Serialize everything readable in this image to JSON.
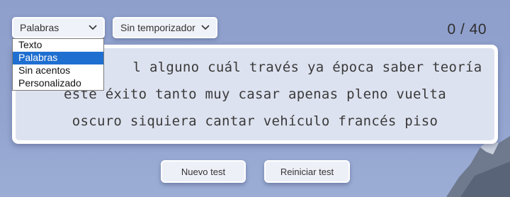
{
  "mode_select": {
    "value": "Palabras",
    "options": [
      "Texto",
      "Palabras",
      "Sin acentos",
      "Personalizado"
    ],
    "highlighted": "Palabras"
  },
  "timer_select": {
    "value": "Sin temporizador"
  },
  "counter": "0 / 40",
  "text_lines": [
    "l alguno cuál través ya época saber teoría",
    "este éxito tanto muy casar apenas pleno vuelta",
    "oscuro siquiera cantar vehículo francés piso"
  ],
  "buttons": {
    "new_test": "Nuevo test",
    "restart_test": "Reiniciar test"
  },
  "icons": {
    "mode_chevron": "chevron-down-icon",
    "timer_chevron": "chevron-down-icon"
  },
  "colors": {
    "background": "#93a4cf",
    "highlight": "#1f6fd0",
    "panel_inner": "#dde2f0"
  }
}
